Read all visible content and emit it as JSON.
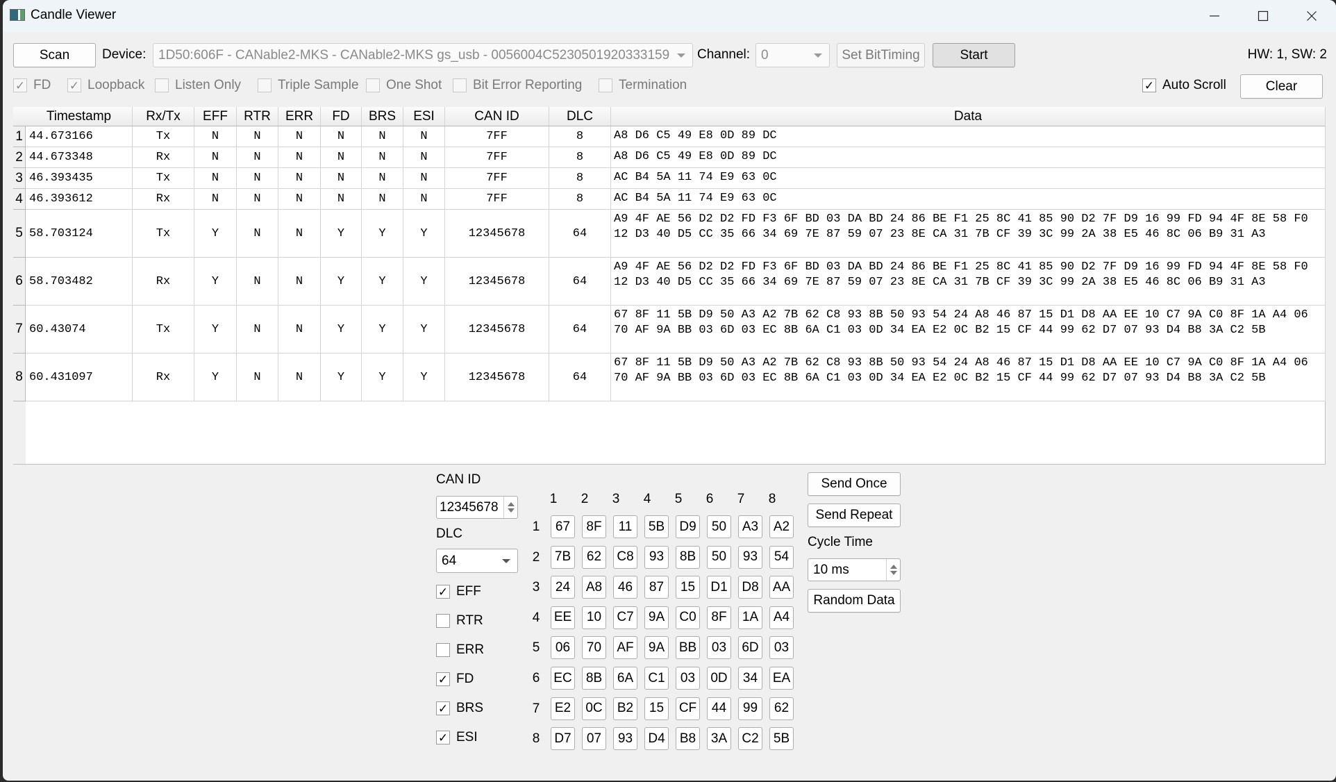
{
  "window": {
    "title": "Candle Viewer",
    "controls": [
      "minimize",
      "maximize",
      "close"
    ]
  },
  "toolbar": {
    "scan_label": "Scan",
    "device_label": "Device:",
    "device_value": "1D50:606F - CANable2-MKS - CANable2-MKS gs_usb - 0056004C5230501920333159",
    "channel_label": "Channel:",
    "channel_value": "0",
    "set_bittiming_label": "Set BitTiming",
    "start_label": "Start",
    "version_text": "HW: 1, SW: 2"
  },
  "options": [
    {
      "label": "FD",
      "checked": true
    },
    {
      "label": "Loopback",
      "checked": true
    },
    {
      "label": "Listen Only",
      "checked": false
    },
    {
      "label": "Triple Sample",
      "checked": false
    },
    {
      "label": "One Shot",
      "checked": false
    },
    {
      "label": "Bit Error Reporting",
      "checked": false
    },
    {
      "label": "Termination",
      "checked": false
    }
  ],
  "auto_scroll": {
    "label": "Auto Scroll",
    "checked": true
  },
  "clear_label": "Clear",
  "table": {
    "columns": [
      "Timestamp",
      "Rx/Tx",
      "EFF",
      "RTR",
      "ERR",
      "FD",
      "BRS",
      "ESI",
      "CAN ID",
      "DLC",
      "Data"
    ],
    "rows": [
      {
        "n": "1",
        "ts": "44.673166",
        "dir": "Tx",
        "eff": "N",
        "rtr": "N",
        "err": "N",
        "fd": "N",
        "brs": "N",
        "esi": "N",
        "id": "7FF",
        "dlc": "8",
        "data": "A8 D6 C5 49 E8 0D 89 DC"
      },
      {
        "n": "2",
        "ts": "44.673348",
        "dir": "Rx",
        "eff": "N",
        "rtr": "N",
        "err": "N",
        "fd": "N",
        "brs": "N",
        "esi": "N",
        "id": "7FF",
        "dlc": "8",
        "data": "A8 D6 C5 49 E8 0D 89 DC"
      },
      {
        "n": "3",
        "ts": "46.393435",
        "dir": "Tx",
        "eff": "N",
        "rtr": "N",
        "err": "N",
        "fd": "N",
        "brs": "N",
        "esi": "N",
        "id": "7FF",
        "dlc": "8",
        "data": "AC B4 5A 11 74 E9 63 0C"
      },
      {
        "n": "4",
        "ts": "46.393612",
        "dir": "Rx",
        "eff": "N",
        "rtr": "N",
        "err": "N",
        "fd": "N",
        "brs": "N",
        "esi": "N",
        "id": "7FF",
        "dlc": "8",
        "data": "AC B4 5A 11 74 E9 63 0C"
      },
      {
        "n": "5",
        "ts": "58.703124",
        "dir": "Tx",
        "eff": "Y",
        "rtr": "N",
        "err": "N",
        "fd": "Y",
        "brs": "Y",
        "esi": "Y",
        "id": "12345678",
        "dlc": "64",
        "data": "A9 4F AE 56 D2 D2 FD F3 6F BD 03 DA BD 24 86 BE F1 25 8C 41 85 90 D2 7F D9 16 99 FD 94 4F 8E 58 F0 12 D3 40 D5 CC 35 66 34 69 7E 87 59 07 23 8E CA 31 7B CF 39 3C 99 2A 38 E5 46 8C 06 B9 31 A3"
      },
      {
        "n": "6",
        "ts": "58.703482",
        "dir": "Rx",
        "eff": "Y",
        "rtr": "N",
        "err": "N",
        "fd": "Y",
        "brs": "Y",
        "esi": "Y",
        "id": "12345678",
        "dlc": "64",
        "data": "A9 4F AE 56 D2 D2 FD F3 6F BD 03 DA BD 24 86 BE F1 25 8C 41 85 90 D2 7F D9 16 99 FD 94 4F 8E 58 F0 12 D3 40 D5 CC 35 66 34 69 7E 87 59 07 23 8E CA 31 7B CF 39 3C 99 2A 38 E5 46 8C 06 B9 31 A3"
      },
      {
        "n": "7",
        "ts": "60.43074",
        "dir": "Tx",
        "eff": "Y",
        "rtr": "N",
        "err": "N",
        "fd": "Y",
        "brs": "Y",
        "esi": "Y",
        "id": "12345678",
        "dlc": "64",
        "data": "67 8F 11 5B D9 50 A3 A2 7B 62 C8 93 8B 50 93 54 24 A8 46 87 15 D1 D8 AA EE 10 C7 9A C0 8F 1A A4 06 70 AF 9A BB 03 6D 03 EC 8B 6A C1 03 0D 34 EA E2 0C B2 15 CF 44 99 62 D7 07 93 D4 B8 3A C2 5B"
      },
      {
        "n": "8",
        "ts": "60.431097",
        "dir": "Rx",
        "eff": "Y",
        "rtr": "N",
        "err": "N",
        "fd": "Y",
        "brs": "Y",
        "esi": "Y",
        "id": "12345678",
        "dlc": "64",
        "data": "67 8F 11 5B D9 50 A3 A2 7B 62 C8 93 8B 50 93 54 24 A8 46 87 15 D1 D8 AA EE 10 C7 9A C0 8F 1A A4 06 70 AF 9A BB 03 6D 03 EC 8B 6A C1 03 0D 34 EA E2 0C B2 15 CF 44 99 62 D7 07 93 D4 B8 3A C2 5B"
      }
    ]
  },
  "send": {
    "can_id_label": "CAN ID",
    "can_id_value": "12345678",
    "dlc_label": "DLC",
    "dlc_value": "64",
    "flags": [
      {
        "label": "EFF",
        "checked": true
      },
      {
        "label": "RTR",
        "checked": false
      },
      {
        "label": "ERR",
        "checked": false
      },
      {
        "label": "FD",
        "checked": true
      },
      {
        "label": "BRS",
        "checked": true
      },
      {
        "label": "ESI",
        "checked": true
      }
    ],
    "col_headers": [
      "1",
      "2",
      "3",
      "4",
      "5",
      "6",
      "7",
      "8"
    ],
    "row_headers": [
      "1",
      "2",
      "3",
      "4",
      "5",
      "6",
      "7",
      "8"
    ],
    "bytes": [
      [
        "67",
        "8F",
        "11",
        "5B",
        "D9",
        "50",
        "A3",
        "A2"
      ],
      [
        "7B",
        "62",
        "C8",
        "93",
        "8B",
        "50",
        "93",
        "54"
      ],
      [
        "24",
        "A8",
        "46",
        "87",
        "15",
        "D1",
        "D8",
        "AA"
      ],
      [
        "EE",
        "10",
        "C7",
        "9A",
        "C0",
        "8F",
        "1A",
        "A4"
      ],
      [
        "06",
        "70",
        "AF",
        "9A",
        "BB",
        "03",
        "6D",
        "03"
      ],
      [
        "EC",
        "8B",
        "6A",
        "C1",
        "03",
        "0D",
        "34",
        "EA"
      ],
      [
        "E2",
        "0C",
        "B2",
        "15",
        "CF",
        "44",
        "99",
        "62"
      ],
      [
        "D7",
        "07",
        "93",
        "D4",
        "B8",
        "3A",
        "C2",
        "5B"
      ]
    ],
    "send_once_label": "Send Once",
    "send_repeat_label": "Send Repeat",
    "cycle_time_label": "Cycle Time",
    "cycle_time_value": "10 ms",
    "random_data_label": "Random Data"
  }
}
